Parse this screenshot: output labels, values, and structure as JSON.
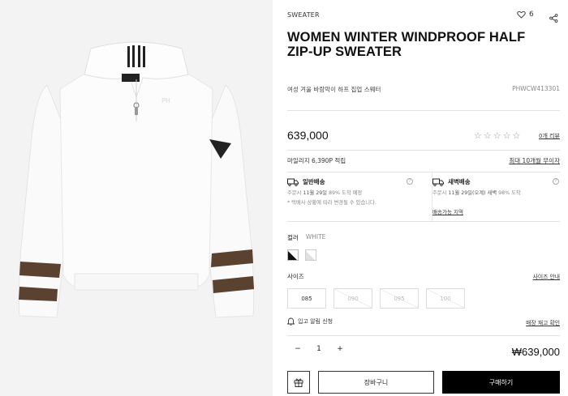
{
  "product": {
    "category": "SWEATER",
    "wish_count": "6",
    "title": "WOMEN WINTER WINDPROOF HALF ZIP-UP SWEATER",
    "subtitle": "여성 겨울 바람막이 하프 집업 스웨터",
    "code": "PHWCW413301",
    "price": "639,000",
    "reviews_link": "0개 리뷰",
    "rating_stars": 0
  },
  "mileage": {
    "text": "마일리지 6,390P 적립",
    "link": "최대 10개월 무이자"
  },
  "shipping": {
    "standard": {
      "title": "일반배송",
      "line1_prefix": "주문시",
      "line1_date": "11월 29일",
      "line1_suffix": "89% 도착 예정",
      "line2": "* 택배사 상황에 따라 변경될 수 있습니다."
    },
    "dawn": {
      "title": "새벽배송",
      "line1_prefix": "주문시",
      "line1_date": "11월 29일(오계) 새벽",
      "line1_suffix": "98% 도착",
      "link": "배송가능 지역"
    }
  },
  "color": {
    "label": "컬러",
    "selected": "WHITE",
    "swatches": [
      "#111111",
      "#f4f4f4"
    ]
  },
  "size": {
    "label": "사이즈",
    "guide": "사이즈 안내",
    "options": [
      {
        "label": "085",
        "available": true
      },
      {
        "label": "090",
        "available": false
      },
      {
        "label": "095",
        "available": false
      },
      {
        "label": "100",
        "available": false
      }
    ]
  },
  "stock": {
    "alert": "입고 알림 신청",
    "link": "매장 재고 확인"
  },
  "order": {
    "quantity": "1",
    "minus": "−",
    "plus": "+",
    "total": "₩639,000",
    "cart_label": "장바구니",
    "buy_label": "구매하기"
  },
  "colors": {
    "image_bg": "#f3f3f3",
    "stripe": "#5a4130",
    "buy_bg": "#000000"
  }
}
